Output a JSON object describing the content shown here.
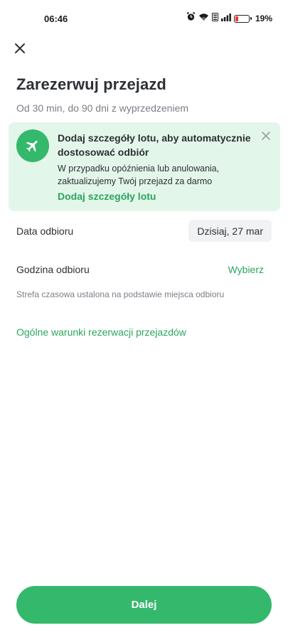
{
  "status_bar": {
    "time": "06:46",
    "battery_percent_label": "19%",
    "battery_level": 0.19,
    "icons": [
      "alarm-icon",
      "wifi-icon",
      "volte-icon",
      "signal-icon",
      "battery-icon"
    ]
  },
  "header": {
    "close_icon": "close-icon",
    "title": "Zarezerwuj przejazd",
    "subtitle": "Od 30 min, do 90 dni z wyprzedzeniem"
  },
  "flight_banner": {
    "icon": "airplane-icon",
    "title": "Dodaj szczegóły lotu, aby automatycznie dostosować odbiór",
    "text": "W przypadku opóźnienia lub anulowania, zaktualizujemy Twój przejazd za darmo",
    "link": "Dodaj szczegóły lotu",
    "background_color": "#e3f6ea",
    "accent_color": "#34b86c"
  },
  "pickup": {
    "date_label": "Data odbioru",
    "date_value": "Dzisiaj, 27 mar",
    "time_label": "Godzina odbioru",
    "time_action": "Wybierz",
    "timezone_note": "Strefa czasowa ustalona na podstawie miejsca odbioru"
  },
  "terms_link": "Ogólne warunki rezerwacji przejazdów",
  "footer": {
    "next_label": "Dalej",
    "button_color": "#34b86c"
  }
}
